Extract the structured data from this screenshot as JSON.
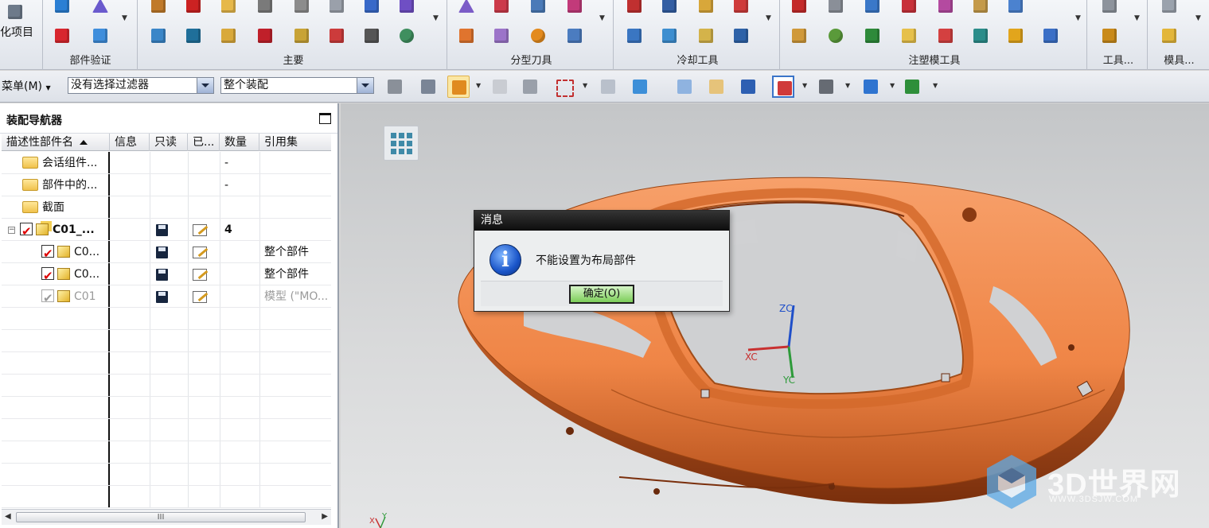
{
  "ribbon": {
    "left_partial_label": "化项目",
    "groups": [
      {
        "label": "部件验证"
      },
      {
        "label": "主要"
      },
      {
        "label": "分型刀具"
      },
      {
        "label": "冷却工具"
      },
      {
        "label": "注塑模工具"
      },
      {
        "label": "工具..."
      },
      {
        "label": "模具..."
      }
    ]
  },
  "command_bar": {
    "menu_label": "菜单(M)",
    "filter_value": "没有选择过滤器",
    "scope_value": "整个装配"
  },
  "navigator": {
    "title": "装配导航器",
    "columns": [
      "描述性部件名",
      "信息",
      "只读",
      "已...",
      "数量",
      "引用集"
    ],
    "rows": [
      {
        "name": "会话组件...",
        "qty": "-",
        "refset": ""
      },
      {
        "name": "部件中的...",
        "qty": "-",
        "refset": ""
      },
      {
        "name": "截面",
        "qty": "",
        "refset": ""
      },
      {
        "name": "C01_...",
        "qty": "4",
        "refset": ""
      },
      {
        "name": "C0...",
        "qty": "",
        "refset": "整个部件"
      },
      {
        "name": "C0...",
        "qty": "",
        "refset": "整个部件"
      },
      {
        "name": "C01",
        "qty": "",
        "refset": "模型 (\"MO..."
      }
    ],
    "scroll_thumb": "III"
  },
  "dialog": {
    "title": "消息",
    "message": "不能设置为布局部件",
    "ok_label": "确定(O)"
  },
  "viewport": {
    "axis_labels": {
      "z": "ZC",
      "x": "XC",
      "y": "YC"
    },
    "triad_x": "X",
    "triad_y": "Y"
  },
  "watermark": {
    "main": "3D世界网",
    "sub": "WWW.3DSJW.COM"
  },
  "colors": {
    "model_orange": "#f08a48",
    "dialog_title": "#1a1a1a",
    "ok_button": "#8fd66a"
  }
}
